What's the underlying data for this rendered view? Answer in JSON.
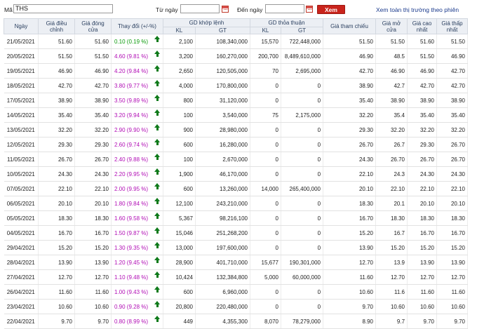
{
  "filters": {
    "ticker_label": "Mã",
    "ticker_value": "THS",
    "from_label": "Từ ngày",
    "from_value": "",
    "to_label": "Đến ngày",
    "to_value": "",
    "submit_label": "Xem",
    "view_all_label": "Xem toàn thị trường theo phiên"
  },
  "colors": {
    "header_bg": "#eceff4",
    "submit_bg": "#c9241c",
    "change_first": "#0a9a0a",
    "change_rest": "#b10db5",
    "arrow": "#0e7a1a"
  },
  "table": {
    "headers": {
      "date": "Ngày",
      "adj": "Giá điều chỉnh",
      "close": "Giá đóng cửa",
      "change": "Thay đổi (+/-%)",
      "matched_group": "GD khớp lệnh",
      "matched_kl": "KL",
      "matched_gt": "GT",
      "deal_group": "GD thỏa thuận",
      "deal_kl": "KL",
      "deal_gt": "GT",
      "ref": "Giá tham chiếu",
      "open": "Giá mở cửa",
      "high": "Giá cao nhất",
      "low": "Giá thấp nhất"
    },
    "rows": [
      {
        "date": "21/05/2021",
        "adj": "51.60",
        "close": "51.60",
        "change": "0.10 (0.19 %)",
        "mkl": "2,100",
        "mgt": "108,340,000",
        "dkl": "15,570",
        "dgt": "722,448,000",
        "ref": "51.50",
        "open": "51.50",
        "high": "51.60",
        "low": "51.50"
      },
      {
        "date": "20/05/2021",
        "adj": "51.50",
        "close": "51.50",
        "change": "4.60 (9.81 %)",
        "mkl": "3,200",
        "mgt": "160,270,000",
        "dkl": "200,700",
        "dgt": "8,489,610,000",
        "ref": "46.90",
        "open": "48.5",
        "high": "51.50",
        "low": "46.90"
      },
      {
        "date": "19/05/2021",
        "adj": "46.90",
        "close": "46.90",
        "change": "4.20 (9.84 %)",
        "mkl": "2,650",
        "mgt": "120,505,000",
        "dkl": "70",
        "dgt": "2,695,000",
        "ref": "42.70",
        "open": "46.90",
        "high": "46.90",
        "low": "42.70"
      },
      {
        "date": "18/05/2021",
        "adj": "42.70",
        "close": "42.70",
        "change": "3.80 (9.77 %)",
        "mkl": "4,000",
        "mgt": "170,800,000",
        "dkl": "0",
        "dgt": "0",
        "ref": "38.90",
        "open": "42.7",
        "high": "42.70",
        "low": "42.70"
      },
      {
        "date": "17/05/2021",
        "adj": "38.90",
        "close": "38.90",
        "change": "3.50 (9.89 %)",
        "mkl": "800",
        "mgt": "31,120,000",
        "dkl": "0",
        "dgt": "0",
        "ref": "35.40",
        "open": "38.90",
        "high": "38.90",
        "low": "38.90"
      },
      {
        "date": "14/05/2021",
        "adj": "35.40",
        "close": "35.40",
        "change": "3.20 (9.94 %)",
        "mkl": "100",
        "mgt": "3,540,000",
        "dkl": "75",
        "dgt": "2,175,000",
        "ref": "32.20",
        "open": "35.4",
        "high": "35.40",
        "low": "35.40"
      },
      {
        "date": "13/05/2021",
        "adj": "32.20",
        "close": "32.20",
        "change": "2.90 (9.90 %)",
        "mkl": "900",
        "mgt": "28,980,000",
        "dkl": "0",
        "dgt": "0",
        "ref": "29.30",
        "open": "32.20",
        "high": "32.20",
        "low": "32.20"
      },
      {
        "date": "12/05/2021",
        "adj": "29.30",
        "close": "29.30",
        "change": "2.60 (9.74 %)",
        "mkl": "600",
        "mgt": "16,280,000",
        "dkl": "0",
        "dgt": "0",
        "ref": "26.70",
        "open": "26.7",
        "high": "29.30",
        "low": "26.70"
      },
      {
        "date": "11/05/2021",
        "adj": "26.70",
        "close": "26.70",
        "change": "2.40 (9.88 %)",
        "mkl": "100",
        "mgt": "2,670,000",
        "dkl": "0",
        "dgt": "0",
        "ref": "24.30",
        "open": "26.70",
        "high": "26.70",
        "low": "26.70"
      },
      {
        "date": "10/05/2021",
        "adj": "24.30",
        "close": "24.30",
        "change": "2.20 (9.95 %)",
        "mkl": "1,900",
        "mgt": "46,170,000",
        "dkl": "0",
        "dgt": "0",
        "ref": "22.10",
        "open": "24.3",
        "high": "24.30",
        "low": "24.30"
      },
      {
        "date": "07/05/2021",
        "adj": "22.10",
        "close": "22.10",
        "change": "2.00 (9.95 %)",
        "mkl": "600",
        "mgt": "13,260,000",
        "dkl": "14,000",
        "dgt": "265,400,000",
        "ref": "20.10",
        "open": "22.10",
        "high": "22.10",
        "low": "22.10"
      },
      {
        "date": "06/05/2021",
        "adj": "20.10",
        "close": "20.10",
        "change": "1.80 (9.84 %)",
        "mkl": "12,100",
        "mgt": "243,210,000",
        "dkl": "0",
        "dgt": "0",
        "ref": "18.30",
        "open": "20.1",
        "high": "20.10",
        "low": "20.10"
      },
      {
        "date": "05/05/2021",
        "adj": "18.30",
        "close": "18.30",
        "change": "1.60 (9.58 %)",
        "mkl": "5,367",
        "mgt": "98,216,100",
        "dkl": "0",
        "dgt": "0",
        "ref": "16.70",
        "open": "18.30",
        "high": "18.30",
        "low": "18.30"
      },
      {
        "date": "04/05/2021",
        "adj": "16.70",
        "close": "16.70",
        "change": "1.50 (9.87 %)",
        "mkl": "15,046",
        "mgt": "251,268,200",
        "dkl": "0",
        "dgt": "0",
        "ref": "15.20",
        "open": "16.7",
        "high": "16.70",
        "low": "16.70"
      },
      {
        "date": "29/04/2021",
        "adj": "15.20",
        "close": "15.20",
        "change": "1.30 (9.35 %)",
        "mkl": "13,000",
        "mgt": "197,600,000",
        "dkl": "0",
        "dgt": "0",
        "ref": "13.90",
        "open": "15.20",
        "high": "15.20",
        "low": "15.20"
      },
      {
        "date": "28/04/2021",
        "adj": "13.90",
        "close": "13.90",
        "change": "1.20 (9.45 %)",
        "mkl": "28,900",
        "mgt": "401,710,000",
        "dkl": "15,677",
        "dgt": "190,301,000",
        "ref": "12.70",
        "open": "13.9",
        "high": "13.90",
        "low": "13.90"
      },
      {
        "date": "27/04/2021",
        "adj": "12.70",
        "close": "12.70",
        "change": "1.10 (9.48 %)",
        "mkl": "10,424",
        "mgt": "132,384,800",
        "dkl": "5,000",
        "dgt": "60,000,000",
        "ref": "11.60",
        "open": "12.70",
        "high": "12.70",
        "low": "12.70"
      },
      {
        "date": "26/04/2021",
        "adj": "11.60",
        "close": "11.60",
        "change": "1.00 (9.43 %)",
        "mkl": "600",
        "mgt": "6,960,000",
        "dkl": "0",
        "dgt": "0",
        "ref": "10.60",
        "open": "11.6",
        "high": "11.60",
        "low": "11.60"
      },
      {
        "date": "23/04/2021",
        "adj": "10.60",
        "close": "10.60",
        "change": "0.90 (9.28 %)",
        "mkl": "20,800",
        "mgt": "220,480,000",
        "dkl": "0",
        "dgt": "0",
        "ref": "9.70",
        "open": "10.60",
        "high": "10.60",
        "low": "10.60"
      },
      {
        "date": "22/04/2021",
        "adj": "9.70",
        "close": "9.70",
        "change": "0.80 (8.99 %)",
        "mkl": "449",
        "mgt": "4,355,300",
        "dkl": "8,070",
        "dgt": "78,279,000",
        "ref": "8.90",
        "open": "9.7",
        "high": "9.70",
        "low": "9.70"
      }
    ]
  }
}
